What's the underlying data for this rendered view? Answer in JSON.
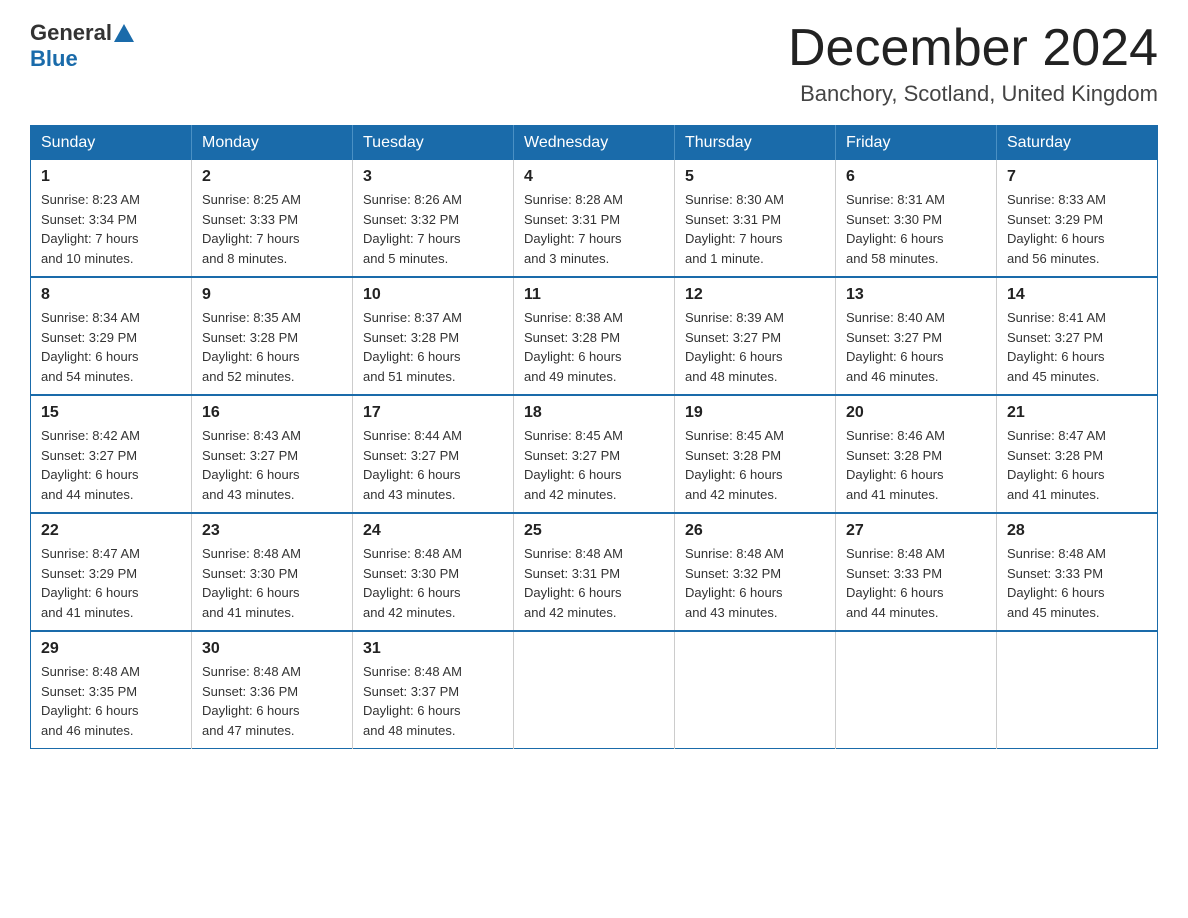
{
  "header": {
    "logo_general": "General",
    "logo_blue": "Blue",
    "month_title": "December 2024",
    "location": "Banchory, Scotland, United Kingdom"
  },
  "days_of_week": [
    "Sunday",
    "Monday",
    "Tuesday",
    "Wednesday",
    "Thursday",
    "Friday",
    "Saturday"
  ],
  "weeks": [
    [
      {
        "day": "1",
        "sunrise": "Sunrise: 8:23 AM",
        "sunset": "Sunset: 3:34 PM",
        "daylight": "Daylight: 7 hours",
        "daylight2": "and 10 minutes."
      },
      {
        "day": "2",
        "sunrise": "Sunrise: 8:25 AM",
        "sunset": "Sunset: 3:33 PM",
        "daylight": "Daylight: 7 hours",
        "daylight2": "and 8 minutes."
      },
      {
        "day": "3",
        "sunrise": "Sunrise: 8:26 AM",
        "sunset": "Sunset: 3:32 PM",
        "daylight": "Daylight: 7 hours",
        "daylight2": "and 5 minutes."
      },
      {
        "day": "4",
        "sunrise": "Sunrise: 8:28 AM",
        "sunset": "Sunset: 3:31 PM",
        "daylight": "Daylight: 7 hours",
        "daylight2": "and 3 minutes."
      },
      {
        "day": "5",
        "sunrise": "Sunrise: 8:30 AM",
        "sunset": "Sunset: 3:31 PM",
        "daylight": "Daylight: 7 hours",
        "daylight2": "and 1 minute."
      },
      {
        "day": "6",
        "sunrise": "Sunrise: 8:31 AM",
        "sunset": "Sunset: 3:30 PM",
        "daylight": "Daylight: 6 hours",
        "daylight2": "and 58 minutes."
      },
      {
        "day": "7",
        "sunrise": "Sunrise: 8:33 AM",
        "sunset": "Sunset: 3:29 PM",
        "daylight": "Daylight: 6 hours",
        "daylight2": "and 56 minutes."
      }
    ],
    [
      {
        "day": "8",
        "sunrise": "Sunrise: 8:34 AM",
        "sunset": "Sunset: 3:29 PM",
        "daylight": "Daylight: 6 hours",
        "daylight2": "and 54 minutes."
      },
      {
        "day": "9",
        "sunrise": "Sunrise: 8:35 AM",
        "sunset": "Sunset: 3:28 PM",
        "daylight": "Daylight: 6 hours",
        "daylight2": "and 52 minutes."
      },
      {
        "day": "10",
        "sunrise": "Sunrise: 8:37 AM",
        "sunset": "Sunset: 3:28 PM",
        "daylight": "Daylight: 6 hours",
        "daylight2": "and 51 minutes."
      },
      {
        "day": "11",
        "sunrise": "Sunrise: 8:38 AM",
        "sunset": "Sunset: 3:28 PM",
        "daylight": "Daylight: 6 hours",
        "daylight2": "and 49 minutes."
      },
      {
        "day": "12",
        "sunrise": "Sunrise: 8:39 AM",
        "sunset": "Sunset: 3:27 PM",
        "daylight": "Daylight: 6 hours",
        "daylight2": "and 48 minutes."
      },
      {
        "day": "13",
        "sunrise": "Sunrise: 8:40 AM",
        "sunset": "Sunset: 3:27 PM",
        "daylight": "Daylight: 6 hours",
        "daylight2": "and 46 minutes."
      },
      {
        "day": "14",
        "sunrise": "Sunrise: 8:41 AM",
        "sunset": "Sunset: 3:27 PM",
        "daylight": "Daylight: 6 hours",
        "daylight2": "and 45 minutes."
      }
    ],
    [
      {
        "day": "15",
        "sunrise": "Sunrise: 8:42 AM",
        "sunset": "Sunset: 3:27 PM",
        "daylight": "Daylight: 6 hours",
        "daylight2": "and 44 minutes."
      },
      {
        "day": "16",
        "sunrise": "Sunrise: 8:43 AM",
        "sunset": "Sunset: 3:27 PM",
        "daylight": "Daylight: 6 hours",
        "daylight2": "and 43 minutes."
      },
      {
        "day": "17",
        "sunrise": "Sunrise: 8:44 AM",
        "sunset": "Sunset: 3:27 PM",
        "daylight": "Daylight: 6 hours",
        "daylight2": "and 43 minutes."
      },
      {
        "day": "18",
        "sunrise": "Sunrise: 8:45 AM",
        "sunset": "Sunset: 3:27 PM",
        "daylight": "Daylight: 6 hours",
        "daylight2": "and 42 minutes."
      },
      {
        "day": "19",
        "sunrise": "Sunrise: 8:45 AM",
        "sunset": "Sunset: 3:28 PM",
        "daylight": "Daylight: 6 hours",
        "daylight2": "and 42 minutes."
      },
      {
        "day": "20",
        "sunrise": "Sunrise: 8:46 AM",
        "sunset": "Sunset: 3:28 PM",
        "daylight": "Daylight: 6 hours",
        "daylight2": "and 41 minutes."
      },
      {
        "day": "21",
        "sunrise": "Sunrise: 8:47 AM",
        "sunset": "Sunset: 3:28 PM",
        "daylight": "Daylight: 6 hours",
        "daylight2": "and 41 minutes."
      }
    ],
    [
      {
        "day": "22",
        "sunrise": "Sunrise: 8:47 AM",
        "sunset": "Sunset: 3:29 PM",
        "daylight": "Daylight: 6 hours",
        "daylight2": "and 41 minutes."
      },
      {
        "day": "23",
        "sunrise": "Sunrise: 8:48 AM",
        "sunset": "Sunset: 3:30 PM",
        "daylight": "Daylight: 6 hours",
        "daylight2": "and 41 minutes."
      },
      {
        "day": "24",
        "sunrise": "Sunrise: 8:48 AM",
        "sunset": "Sunset: 3:30 PM",
        "daylight": "Daylight: 6 hours",
        "daylight2": "and 42 minutes."
      },
      {
        "day": "25",
        "sunrise": "Sunrise: 8:48 AM",
        "sunset": "Sunset: 3:31 PM",
        "daylight": "Daylight: 6 hours",
        "daylight2": "and 42 minutes."
      },
      {
        "day": "26",
        "sunrise": "Sunrise: 8:48 AM",
        "sunset": "Sunset: 3:32 PM",
        "daylight": "Daylight: 6 hours",
        "daylight2": "and 43 minutes."
      },
      {
        "day": "27",
        "sunrise": "Sunrise: 8:48 AM",
        "sunset": "Sunset: 3:33 PM",
        "daylight": "Daylight: 6 hours",
        "daylight2": "and 44 minutes."
      },
      {
        "day": "28",
        "sunrise": "Sunrise: 8:48 AM",
        "sunset": "Sunset: 3:33 PM",
        "daylight": "Daylight: 6 hours",
        "daylight2": "and 45 minutes."
      }
    ],
    [
      {
        "day": "29",
        "sunrise": "Sunrise: 8:48 AM",
        "sunset": "Sunset: 3:35 PM",
        "daylight": "Daylight: 6 hours",
        "daylight2": "and 46 minutes."
      },
      {
        "day": "30",
        "sunrise": "Sunrise: 8:48 AM",
        "sunset": "Sunset: 3:36 PM",
        "daylight": "Daylight: 6 hours",
        "daylight2": "and 47 minutes."
      },
      {
        "day": "31",
        "sunrise": "Sunrise: 8:48 AM",
        "sunset": "Sunset: 3:37 PM",
        "daylight": "Daylight: 6 hours",
        "daylight2": "and 48 minutes."
      },
      null,
      null,
      null,
      null
    ]
  ]
}
